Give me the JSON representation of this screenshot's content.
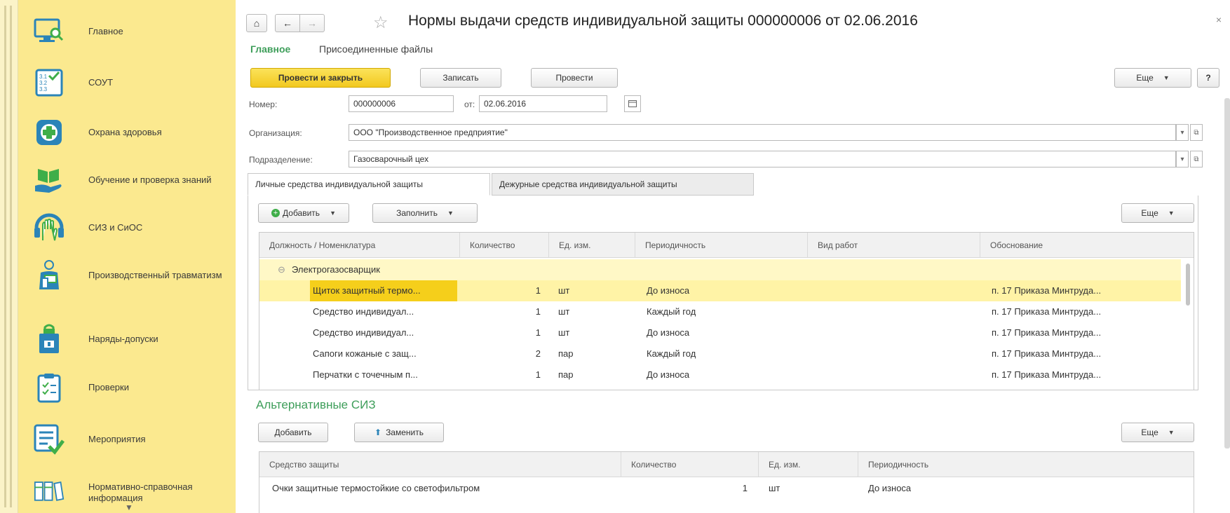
{
  "sidebar": {
    "items": [
      {
        "label": "Главное",
        "icon": "monitor-search-icon"
      },
      {
        "label": "СОУТ",
        "icon": "checklist-icon"
      },
      {
        "label": "Охрана здоровья",
        "icon": "medical-cross-icon"
      },
      {
        "label": "Обучение и проверка знаний",
        "icon": "book-hand-icon"
      },
      {
        "label": "СИЗ и СиОС",
        "icon": "glove-icon"
      },
      {
        "label": "Производственный травматизм",
        "icon": "injured-person-icon"
      },
      {
        "label": "Наряды-допуски",
        "icon": "lock-document-icon"
      },
      {
        "label": "Проверки",
        "icon": "clipboard-check-icon"
      },
      {
        "label": "Мероприятия",
        "icon": "list-check-icon"
      },
      {
        "label": "Нормативно-справочная информация",
        "icon": "binders-icon"
      }
    ],
    "colors": {
      "background": "#fbe98f",
      "icon": "#2b84b8",
      "accent": "#3fae49"
    }
  },
  "header": {
    "title": "Нормы выдачи средств индивидуальной защиты 000000006 от 02.06.2016",
    "home_glyph": "⌂",
    "back_glyph": "←",
    "forward_glyph": "→",
    "favorite_glyph": "☆",
    "close_glyph": "×"
  },
  "section_tabs": [
    {
      "label": "Главное",
      "active": true
    },
    {
      "label": "Присоединенные файлы",
      "active": false
    }
  ],
  "toolbar": {
    "post_close_label": "Провести и закрыть",
    "save_label": "Записать",
    "post_label": "Провести",
    "more_label": "Еще",
    "help_label": "?"
  },
  "form": {
    "number_label": "Номер:",
    "number_value": "000000006",
    "date_label": "от:",
    "date_value": "02.06.2016",
    "org_label": "Организация:",
    "org_value": "ООО \"Производственное предприятие\"",
    "dept_label": "Подразделение:",
    "dept_value": "Газосварочный цех"
  },
  "tabs": [
    {
      "label": "Личные средства индивидуальной защиты",
      "active": true
    },
    {
      "label": "Дежурные средства индивидуальной защиты",
      "active": false
    }
  ],
  "items_toolbar": {
    "add_label": "Добавить",
    "fill_label": "Заполнить",
    "more_label": "Еще"
  },
  "items_table": {
    "columns": [
      "Должность / Номенклатура",
      "Количество",
      "Ед. изм.",
      "Периодичность",
      "Вид работ",
      "Обоснование"
    ],
    "group": {
      "toggle": "⊖",
      "label": "Электрогазосварщик"
    },
    "rows": [
      {
        "name": "Щиток защитный термо...",
        "qty": "1",
        "unit": "шт",
        "period": "До износа",
        "work": "",
        "basis": "п. 17 Приказа Минтруда..."
      },
      {
        "name": "Средство индивидуал...",
        "qty": "1",
        "unit": "шт",
        "period": "Каждый год",
        "work": "",
        "basis": "п. 17 Приказа Минтруда..."
      },
      {
        "name": "Средство индивидуал...",
        "qty": "1",
        "unit": "шт",
        "period": "До износа",
        "work": "",
        "basis": "п. 17 Приказа Минтруда..."
      },
      {
        "name": "Сапоги кожаные с защ...",
        "qty": "2",
        "unit": "пар",
        "period": "Каждый год",
        "work": "",
        "basis": "п. 17 Приказа Минтруда..."
      },
      {
        "name": "Перчатки с точечным п...",
        "qty": "1",
        "unit": "пар",
        "period": "До износа",
        "work": "",
        "basis": "п. 17 Приказа Минтруда..."
      }
    ]
  },
  "alternatives": {
    "title": "Альтернативные СИЗ",
    "add_label": "Добавить",
    "replace_label": "Заменить",
    "more_label": "Еще",
    "columns": [
      "Средство защиты",
      "Количество",
      "Ед. изм.",
      "Периодичность"
    ],
    "rows": [
      {
        "name": "Очки защитные термостойкие со светофильтром",
        "qty": "1",
        "unit": "шт",
        "period": "До износа"
      }
    ]
  }
}
